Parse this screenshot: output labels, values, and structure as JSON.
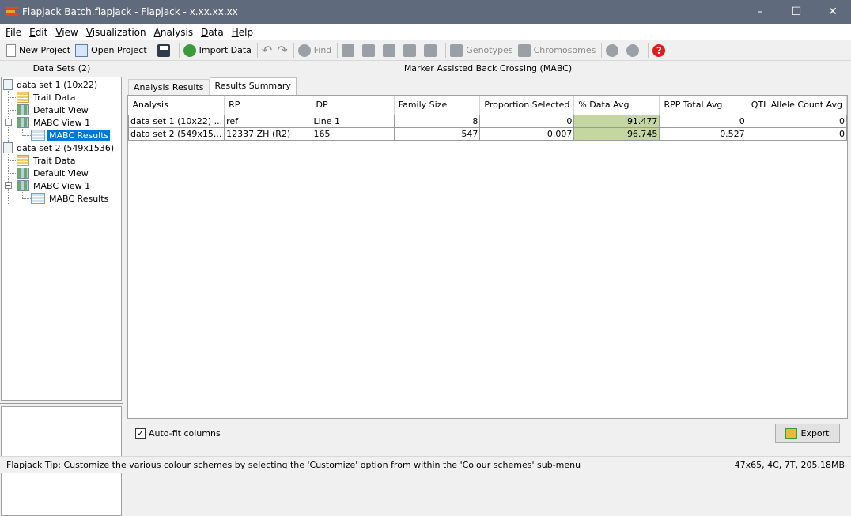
{
  "window": {
    "title": "Flapjack Batch.flapjack - Flapjack - x.xx.xx.xx",
    "controls": [
      "–",
      "☐",
      "✕"
    ]
  },
  "menu": [
    {
      "accel": "F",
      "rest": "ile"
    },
    {
      "accel": "E",
      "rest": "dit"
    },
    {
      "accel": "V",
      "rest": "iew"
    },
    {
      "accel": "V",
      "rest": "isualization"
    },
    {
      "accel": "A",
      "rest": "nalysis"
    },
    {
      "accel": "D",
      "rest": "ata"
    },
    {
      "accel": "H",
      "rest": "elp"
    }
  ],
  "toolbar": {
    "new_project": "New Project",
    "open_project": "Open Project",
    "import_data": "Import Data",
    "find": "Find",
    "genotypes": "Genotypes",
    "chromosomes": "Chromosomes"
  },
  "left_panel": {
    "header": "Data Sets (2)",
    "tree": [
      {
        "label": "data set 1 (10x22)"
      },
      {
        "label": "Trait Data"
      },
      {
        "label": "Default View"
      },
      {
        "label": "MABC View 1"
      },
      {
        "label": "MABC Results"
      },
      {
        "label": "data set 2 (549x1536)"
      },
      {
        "label": "Trait Data"
      },
      {
        "label": "Default View"
      },
      {
        "label": "MABC View 1"
      },
      {
        "label": "MABC Results"
      }
    ]
  },
  "right_panel": {
    "header": "Marker Assisted Back Crossing (MABC)",
    "tabs": [
      "Analysis Results",
      "Results Summary"
    ],
    "active_tab": "Results Summary",
    "table": {
      "columns": [
        "Analysis",
        "RP",
        "DP",
        "Family Size",
        "Proportion Selected",
        "% Data Avg",
        "RPP Total Avg",
        "QTL Allele Count Avg"
      ],
      "rows": [
        [
          "data set 1 (10x22) ...",
          "ref",
          "Line 1",
          "8",
          "0",
          "91.477",
          "0",
          "0"
        ],
        [
          "data set 2 (549x15...",
          "12337 ZH (R2)",
          "165",
          "547",
          "0.007",
          "96.745",
          "0.527",
          "0"
        ]
      ]
    },
    "autofit_label": "Auto-fit columns",
    "autofit_checked": true,
    "export_label": "Export"
  },
  "status": {
    "tip": "Flapjack Tip:  Customize the various colour schemes by selecting the 'Customize' option from within the 'Colour schemes' sub-menu",
    "memory": "47x65, 4C, 7T, 205.18MB"
  },
  "colors": {
    "titlebar": "#5f6b7c",
    "selection": "#0078d7",
    "highlight_cell": "#c4d7a0",
    "help_red": "#e01b1b",
    "import_green": "#3b9a3b"
  }
}
